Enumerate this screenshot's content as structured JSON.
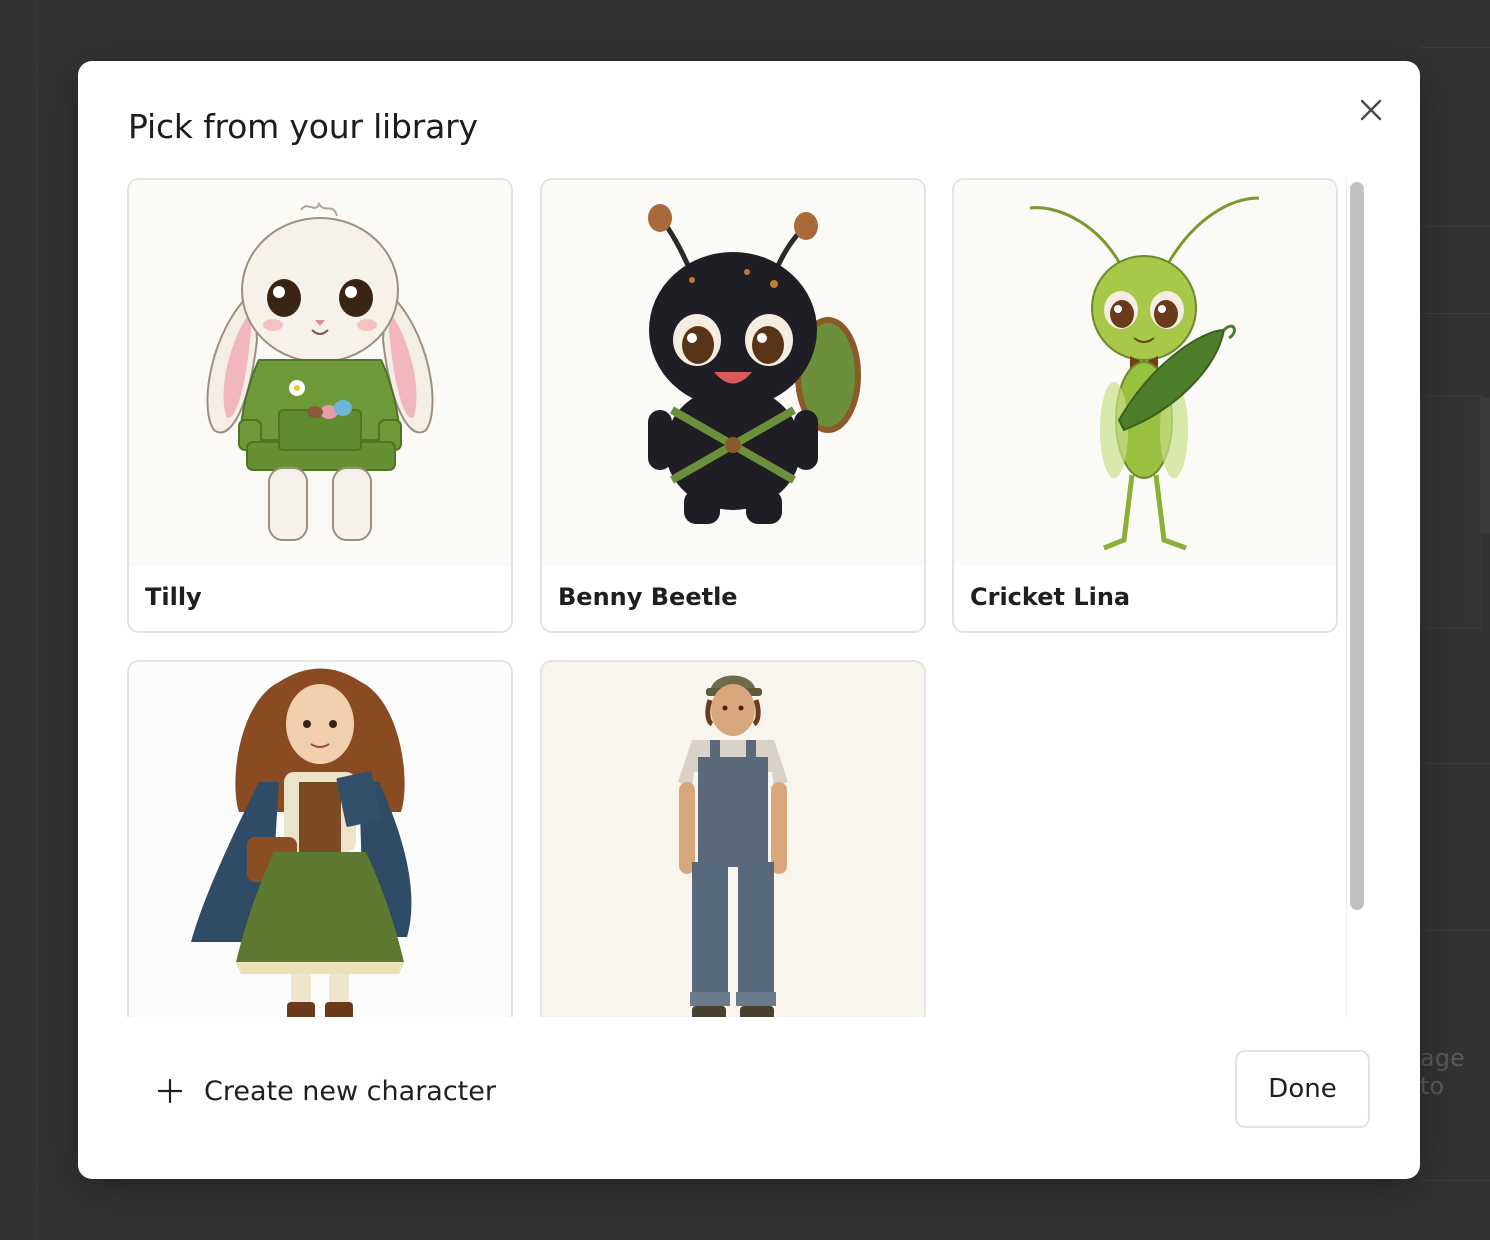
{
  "modal": {
    "title": "Pick from your library",
    "close_icon": "close-icon"
  },
  "characters": [
    {
      "name": "Tilly",
      "art": "bunny-illustration"
    },
    {
      "name": "Benny Beetle",
      "art": "beetle-illustration"
    },
    {
      "name": "Cricket Lina",
      "art": "cricket-illustration"
    },
    {
      "name": "",
      "art": "girl-illustration"
    },
    {
      "name": "",
      "art": "boy-illustration"
    }
  ],
  "footer": {
    "create_label": "Create new character",
    "create_icon": "plus-icon",
    "done_label": "Done"
  },
  "background": {
    "partial_text": "age to"
  },
  "colors": {
    "overlay": "#333333",
    "modal": "#ffffff",
    "card_border": "#e3e3e3",
    "art_background": "#fcfaf6"
  }
}
